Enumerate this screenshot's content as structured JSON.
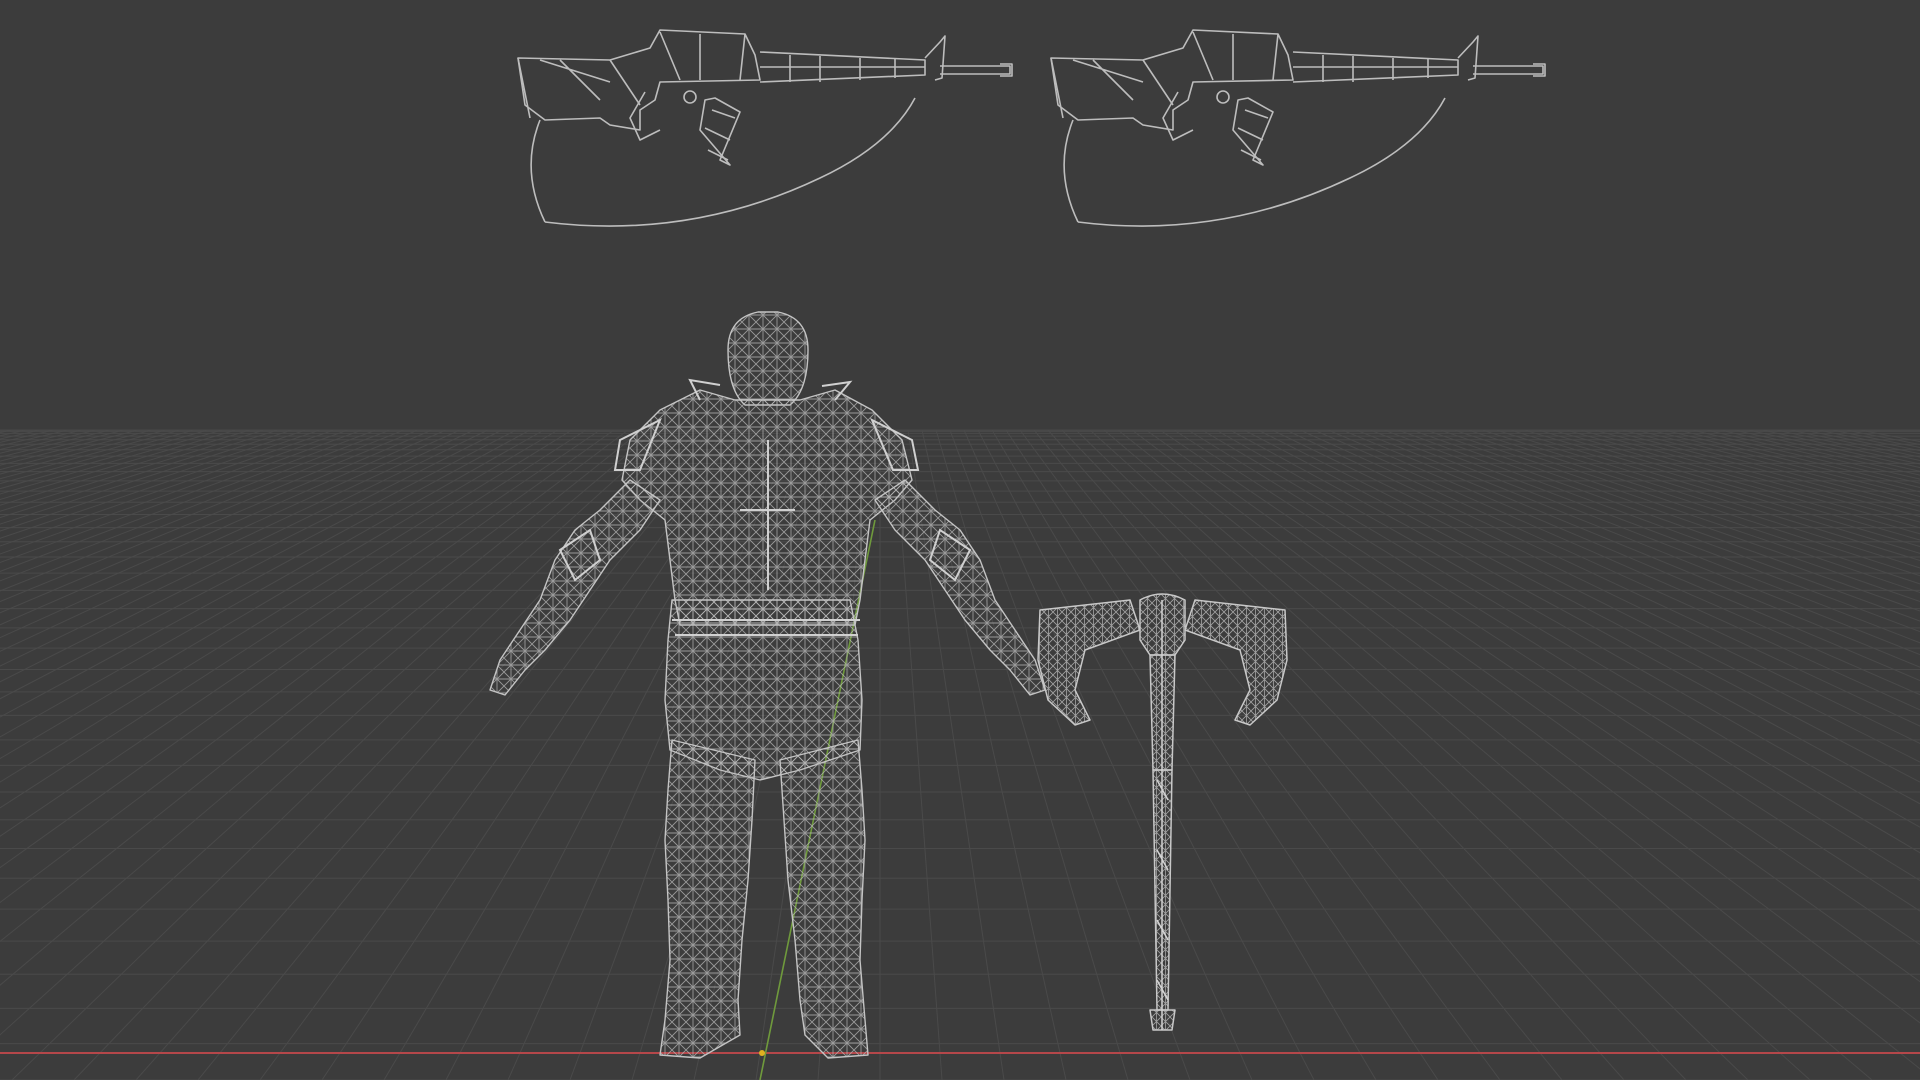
{
  "viewport": {
    "mode": "wireframe",
    "background_color": "#3c3c3c",
    "grid_color": "#4a4a4a",
    "axis_x_color": "#b5474a",
    "axis_y_color": "#6f9a3c",
    "wire_color": "#b8b8b8"
  },
  "objects": [
    {
      "kind": "rifle",
      "icon": "rifle-wireframe"
    },
    {
      "kind": "rifle",
      "icon": "rifle-wireframe"
    },
    {
      "kind": "character",
      "icon": "warrior-wireframe"
    },
    {
      "kind": "axe",
      "icon": "double-axe-wireframe"
    }
  ]
}
